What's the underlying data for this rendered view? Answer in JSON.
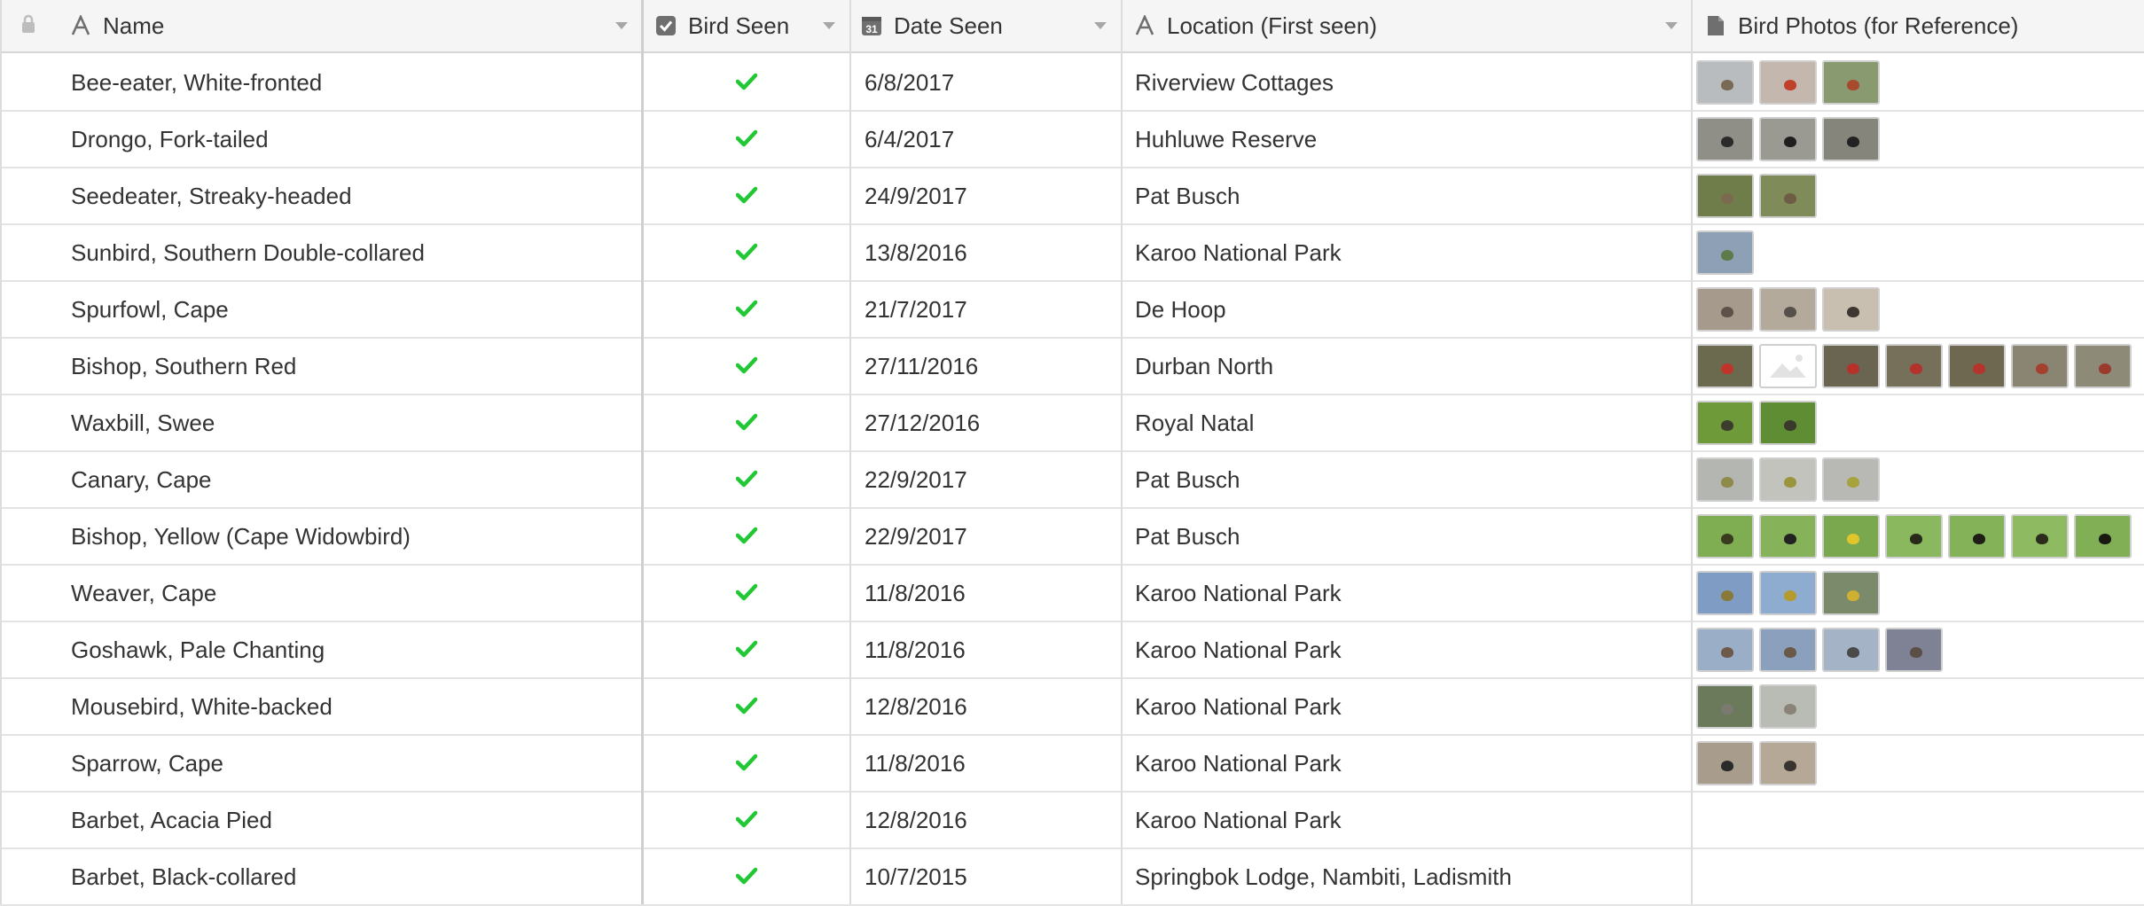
{
  "columns": {
    "name": "Name",
    "bird_seen": "Bird Seen",
    "date_seen": "Date Seen",
    "location": "Location (First seen)",
    "photos": "Bird Photos (for Reference)"
  },
  "icons": {
    "lock": "lock-icon",
    "text_field": "text-field-icon",
    "checkbox_field": "checkbox-field-icon",
    "date_field": "calendar-icon",
    "attachment_field": "document-icon",
    "checkmark": "checkmark-icon",
    "dropdown": "chevron-down-icon",
    "broken_image": "image-placeholder-icon"
  },
  "date_icon_text": "31",
  "colors": {
    "check": "#20c933",
    "header_bg": "#f5f5f5",
    "grid_line": "#e4e4e4"
  },
  "rows": [
    {
      "name": "Bee-eater, White-fronted",
      "seen": true,
      "date": "6/8/2017",
      "location": "Riverview Cottages",
      "photos": [
        {
          "bg": "#b9bcbf",
          "bird": "#7a6a55"
        },
        {
          "bg": "#c4b8ae",
          "bird": "#c0412b"
        },
        {
          "bg": "#8a9a70",
          "bird": "#a84a2d"
        }
      ]
    },
    {
      "name": "Drongo, Fork-tailed",
      "seen": true,
      "date": "6/4/2017",
      "location": "Huhluwe Reserve",
      "photos": [
        {
          "bg": "#8f8f88",
          "bird": "#2b2b2b"
        },
        {
          "bg": "#9a9a92",
          "bird": "#1f1f1f"
        },
        {
          "bg": "#85857c",
          "bird": "#222222"
        }
      ]
    },
    {
      "name": "Seedeater, Streaky-headed",
      "seen": true,
      "date": "24/9/2017",
      "location": "Pat Busch",
      "photos": [
        {
          "bg": "#6f7d4a",
          "bird": "#7c6a4f"
        },
        {
          "bg": "#7f8b58",
          "bird": "#6e5c44"
        }
      ]
    },
    {
      "name": "Sunbird, Southern Double-collared",
      "seen": true,
      "date": "13/8/2016",
      "location": "Karoo National Park",
      "photos": [
        {
          "bg": "#8ea0b5",
          "bird": "#5d7a4a"
        }
      ]
    },
    {
      "name": "Spurfowl, Cape",
      "seen": true,
      "date": "21/7/2017",
      "location": "De Hoop",
      "photos": [
        {
          "bg": "#a69a8c",
          "bird": "#5c5248"
        },
        {
          "bg": "#b3aa9c",
          "bird": "#55504a"
        },
        {
          "bg": "#c9bfb0",
          "bird": "#3e3630"
        }
      ]
    },
    {
      "name": "Bishop, Southern Red",
      "seen": true,
      "date": "27/11/2016",
      "location": "Durban North",
      "photos": [
        {
          "bg": "#6b6a4e",
          "bird": "#c0352a"
        },
        {
          "broken": true
        },
        {
          "bg": "#6a6550",
          "bird": "#b8302a"
        },
        {
          "bg": "#76705a",
          "bird": "#b3322b"
        },
        {
          "bg": "#6e6850",
          "bird": "#b5342b"
        },
        {
          "bg": "#8a8572",
          "bird": "#a4402e"
        },
        {
          "bg": "#8e8a78",
          "bird": "#9c3a2e"
        }
      ]
    },
    {
      "name": "Waxbill, Swee",
      "seen": true,
      "date": "27/12/2016",
      "location": "Royal Natal",
      "photos": [
        {
          "bg": "#6e9a3a",
          "bird": "#3d3d2e"
        },
        {
          "bg": "#5f8d33",
          "bird": "#3a3a2c"
        }
      ]
    },
    {
      "name": "Canary, Cape",
      "seen": true,
      "date": "22/9/2017",
      "location": "Pat Busch",
      "photos": [
        {
          "bg": "#b4b6b2",
          "bird": "#8d8a4a"
        },
        {
          "bg": "#c2c3bd",
          "bird": "#9a9640"
        },
        {
          "bg": "#b8b9b4",
          "bird": "#a8a23c"
        }
      ]
    },
    {
      "name": "Bishop, Yellow (Cape Widowbird)",
      "seen": true,
      "date": "22/9/2017",
      "location": "Pat Busch",
      "photos": [
        {
          "bg": "#7fae52",
          "bird": "#3a3a1e"
        },
        {
          "bg": "#86b35a",
          "bird": "#222222"
        },
        {
          "bg": "#7aa84e",
          "bird": "#e2c52a"
        },
        {
          "bg": "#8ab85e",
          "bird": "#2a2a1a"
        },
        {
          "bg": "#84b258",
          "bird": "#1e1e16"
        },
        {
          "bg": "#8ebb62",
          "bird": "#2c2c1c"
        },
        {
          "bg": "#80af55",
          "bird": "#1a1a12"
        }
      ]
    },
    {
      "name": "Weaver, Cape",
      "seen": true,
      "date": "11/8/2016",
      "location": "Karoo National Park",
      "photos": [
        {
          "bg": "#7f9cc4",
          "bird": "#8a7a3a"
        },
        {
          "bg": "#8eabd0",
          "bird": "#b59a2e"
        },
        {
          "bg": "#7a8a6a",
          "bird": "#d0b030"
        }
      ]
    },
    {
      "name": "Goshawk, Pale Chanting",
      "seen": true,
      "date": "11/8/2016",
      "location": "Karoo National Park",
      "photos": [
        {
          "bg": "#9aaec8",
          "bird": "#6d5a4a"
        },
        {
          "bg": "#8aa0bc",
          "bird": "#6a5848"
        },
        {
          "bg": "#a4b4c6",
          "bird": "#4a4a4a"
        },
        {
          "bg": "#7e8294",
          "bird": "#5a4e46"
        }
      ]
    },
    {
      "name": "Mousebird, White-backed",
      "seen": true,
      "date": "12/8/2016",
      "location": "Karoo National Park",
      "photos": [
        {
          "bg": "#6c7a5c",
          "bird": "#7a7a70"
        },
        {
          "bg": "#b8bcb4",
          "bird": "#8a8478"
        }
      ]
    },
    {
      "name": "Sparrow, Cape",
      "seen": true,
      "date": "11/8/2016",
      "location": "Karoo National Park",
      "photos": [
        {
          "bg": "#a89c8c",
          "bird": "#2a2a2a"
        },
        {
          "bg": "#b5a896",
          "bird": "#3a3430"
        }
      ]
    },
    {
      "name": "Barbet, Acacia Pied",
      "seen": true,
      "date": "12/8/2016",
      "location": "Karoo National Park",
      "photos": []
    },
    {
      "name": "Barbet, Black-collared",
      "seen": true,
      "date": "10/7/2015",
      "location": "Springbok Lodge, Nambiti, Ladismith",
      "photos": []
    }
  ]
}
